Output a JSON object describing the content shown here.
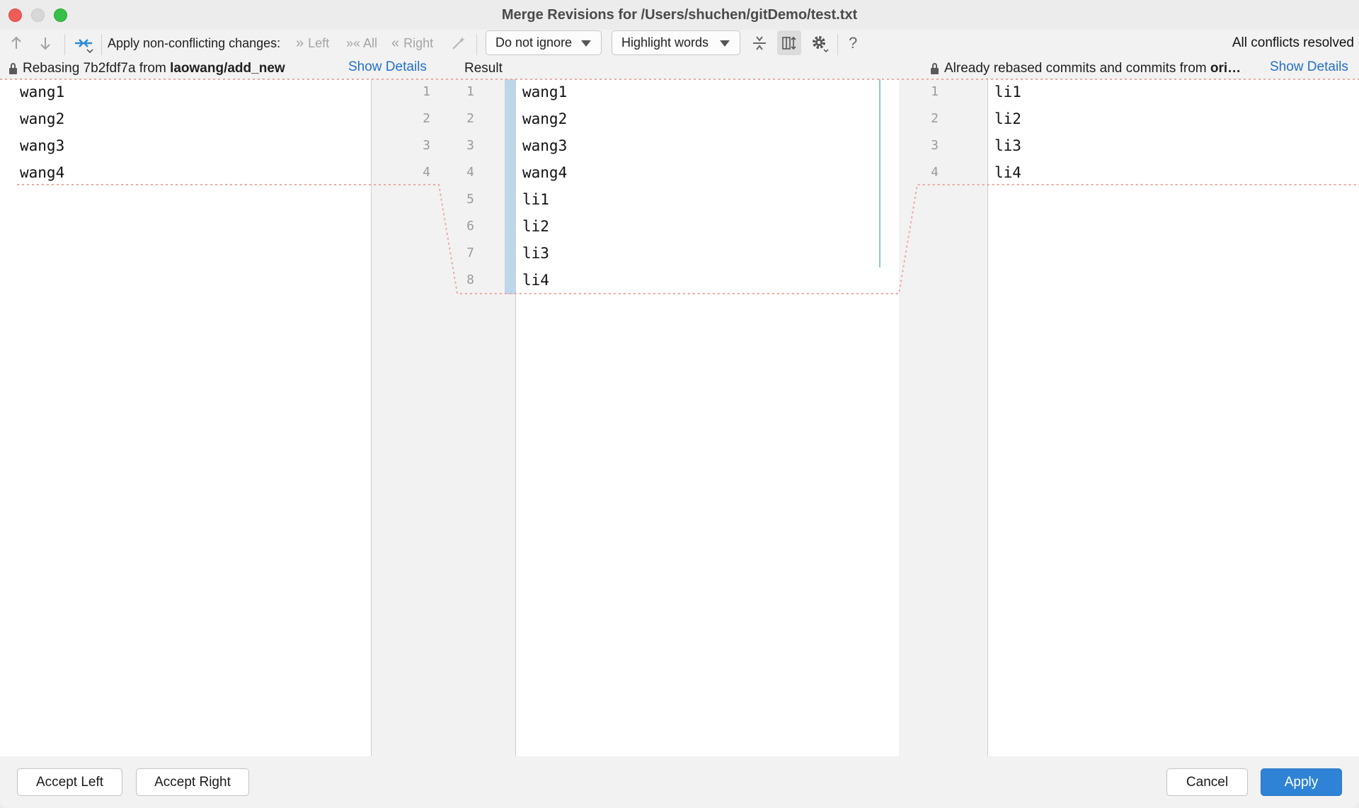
{
  "window": {
    "title": "Merge Revisions for /Users/shuchen/gitDemo/test.txt"
  },
  "toolbar": {
    "apply_label": "Apply non-conflicting changes:",
    "left_label": "Left",
    "all_label": "All",
    "right_label": "Right",
    "ignore_select": "Do not ignore",
    "highlight_select": "Highlight words",
    "help": "?",
    "status": "All conflicts resolved"
  },
  "info": {
    "left_prefix": "Rebasing 7b2fdf7a from ",
    "left_branch": "laowang/add_new",
    "left_link": "Show Details",
    "center_label": "Result",
    "right_prefix": "Already rebased commits and commits from ",
    "right_bold": "ori…",
    "right_link": "Show Details"
  },
  "left_pane": {
    "lines": [
      "wang1",
      "wang2",
      "wang3",
      "wang4"
    ],
    "numbers": [
      "1",
      "2",
      "3",
      "4"
    ]
  },
  "result_pane": {
    "lines": [
      "wang1",
      "wang2",
      "wang3",
      "wang4",
      "li1",
      "li2",
      "li3",
      "li4"
    ],
    "numbers": [
      "1",
      "2",
      "3",
      "4",
      "5",
      "6",
      "7",
      "8"
    ]
  },
  "right_pane": {
    "lines": [
      "li1",
      "li2",
      "li3",
      "li4"
    ],
    "numbers": [
      "1",
      "2",
      "3",
      "4"
    ]
  },
  "buttons": {
    "accept_left": "Accept Left",
    "accept_right": "Accept Right",
    "cancel": "Cancel",
    "apply": "Apply"
  },
  "colors": {
    "accent": "#2f83d6",
    "link": "#2470c8",
    "conflict_border": "#f0a8a0",
    "change_bar": "#bcd6ea"
  }
}
